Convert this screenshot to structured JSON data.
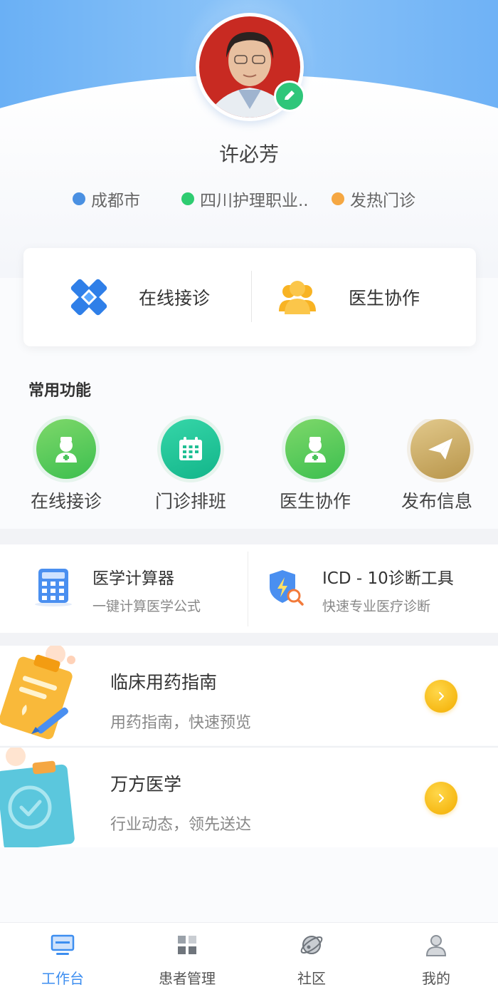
{
  "profile": {
    "name": "许必芳",
    "tags": [
      {
        "label": "成都市",
        "color": "#4a90e2"
      },
      {
        "label": "四川护理职业..",
        "color": "#2ecc71"
      },
      {
        "label": "发热门诊",
        "color": "#f5a742"
      }
    ]
  },
  "quick_actions": [
    {
      "label": "在线接诊",
      "icon": "medical-cross-icon"
    },
    {
      "label": "医生协作",
      "icon": "people-icon"
    }
  ],
  "common": {
    "title": "常用功能",
    "items": [
      {
        "label": "在线接诊",
        "icon": "nurse-icon"
      },
      {
        "label": "门诊排班",
        "icon": "calendar-icon"
      },
      {
        "label": "医生协作",
        "icon": "nurse-icon"
      },
      {
        "label": "发布信息",
        "icon": "paper-plane-icon"
      }
    ]
  },
  "tools": [
    {
      "title": "医学计算器",
      "subtitle": "一键计算医学公式",
      "icon": "calculator-icon"
    },
    {
      "title": "ICD - 10诊断工具",
      "subtitle": "快速专业医疗诊断",
      "icon": "shield-search-icon"
    }
  ],
  "guides": [
    {
      "title": "临床用药指南",
      "subtitle": "用药指南，快速预览",
      "icon": "clipboard-pen-icon"
    },
    {
      "title": "万方医学",
      "subtitle": "行业动态，领先送达",
      "icon": "clipboard-check-icon"
    }
  ],
  "tabs": [
    {
      "label": "工作台",
      "icon": "desktop-icon",
      "active": true
    },
    {
      "label": "患者管理",
      "icon": "grid-icon",
      "active": false
    },
    {
      "label": "社区",
      "icon": "planet-icon",
      "active": false
    },
    {
      "label": "我的",
      "icon": "user-icon",
      "active": false
    }
  ],
  "colors": {
    "accent": "#3d8ef0",
    "header_blue": "#6ab0f5",
    "green": "#2fc67a",
    "yellow": "#f5b50e"
  }
}
